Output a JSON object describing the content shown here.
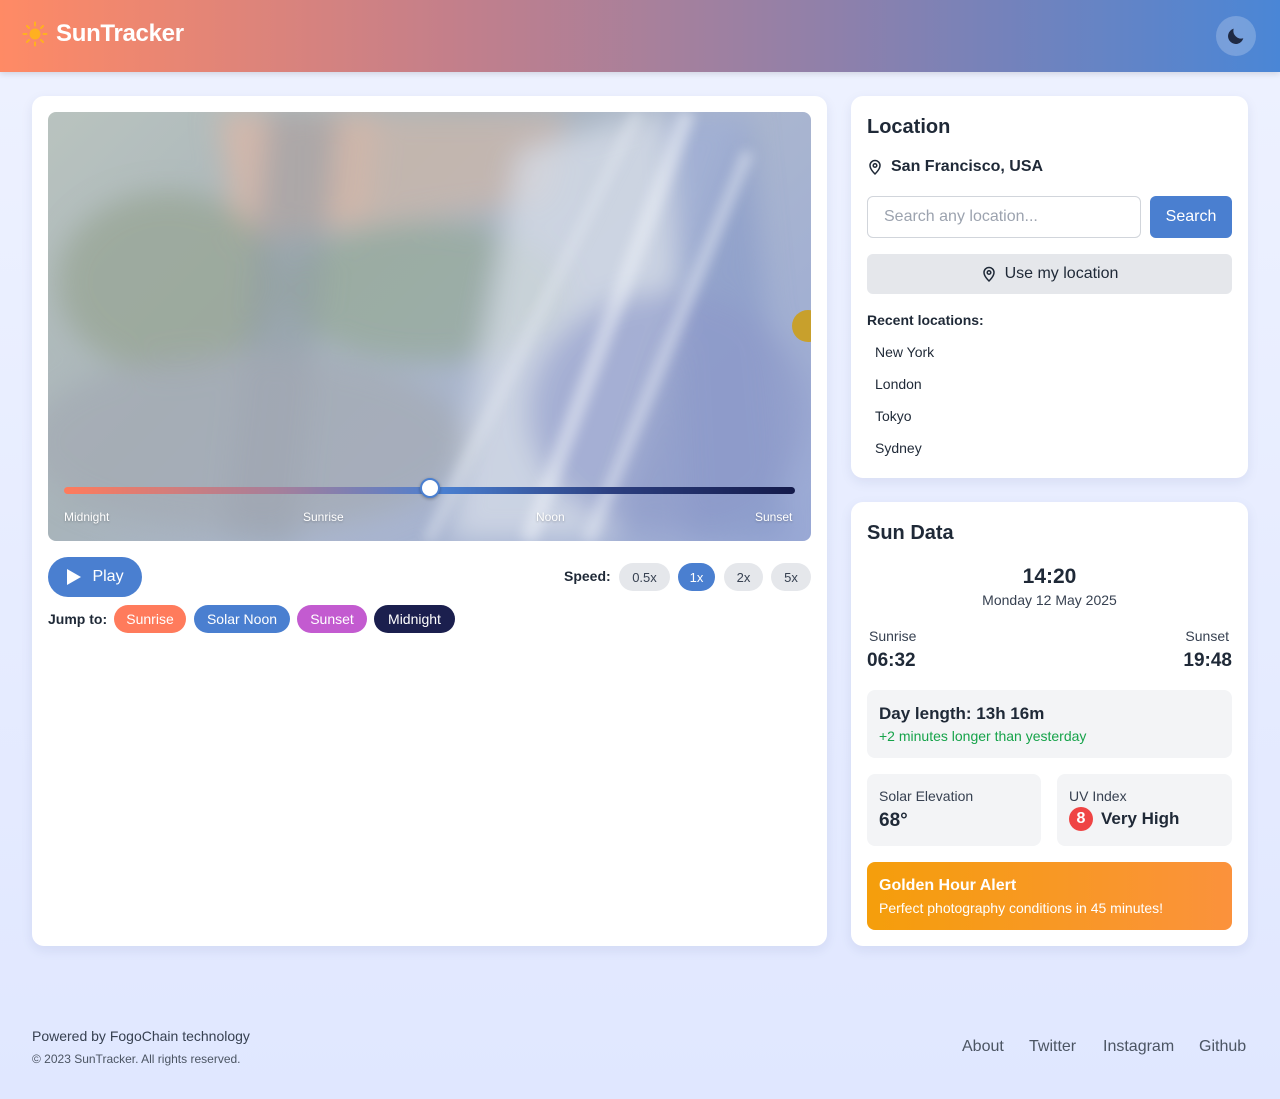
{
  "header": {
    "brand": "SunTracker",
    "brand_icon": "sun-icon",
    "theme_toggle_icon": "moon-icon"
  },
  "timeline": {
    "ticks": [
      "Midnight",
      "Sunrise",
      "Noon",
      "Sunset"
    ],
    "position_percent": 50
  },
  "controls": {
    "play_label": "Play",
    "speed_label": "Speed:",
    "speeds": [
      "0.5x",
      "1x",
      "2x",
      "5x"
    ],
    "active_speed": "1x",
    "jump_label": "Jump to:",
    "jumps": [
      "Sunrise",
      "Solar Noon",
      "Sunset",
      "Midnight"
    ]
  },
  "location": {
    "title": "Location",
    "current": "San Francisco, USA",
    "search_placeholder": "Search any location...",
    "search_button": "Search",
    "use_location": "Use my location",
    "recent_label": "Recent locations:",
    "recent": [
      "New York",
      "London",
      "Tokyo",
      "Sydney"
    ]
  },
  "sun_data": {
    "title": "Sun Data",
    "time": "14:20",
    "date": "Monday 12 May 2025",
    "sunrise_label": "Sunrise",
    "sunrise_time": "06:32",
    "sunset_label": "Sunset",
    "sunset_time": "19:48",
    "day_length": "Day length: 13h 16m",
    "day_change": "+2 minutes longer than yesterday",
    "elevation_label": "Solar Elevation",
    "elevation_value": "68°",
    "uv_label": "UV Index",
    "uv_value": "8",
    "uv_text": "Very High",
    "golden_title": "Golden Hour Alert",
    "golden_text": "Perfect photography conditions in 45 minutes!"
  },
  "footer": {
    "powered": "Powered by FogoChain technology",
    "copyright": "© 2023 SunTracker. All rights reserved.",
    "links": [
      "About",
      "Twitter",
      "Instagram",
      "Github"
    ]
  },
  "colors": {
    "accent": "#4a7fd0",
    "sunrise": "#ff7b5c",
    "solar_noon": "#4a7fd0",
    "sunset": "#c35bd0",
    "midnight": "#1b1f4e",
    "golden": "#f59e0b",
    "uv_high": "#ef4444",
    "positive": "#16a34a"
  }
}
